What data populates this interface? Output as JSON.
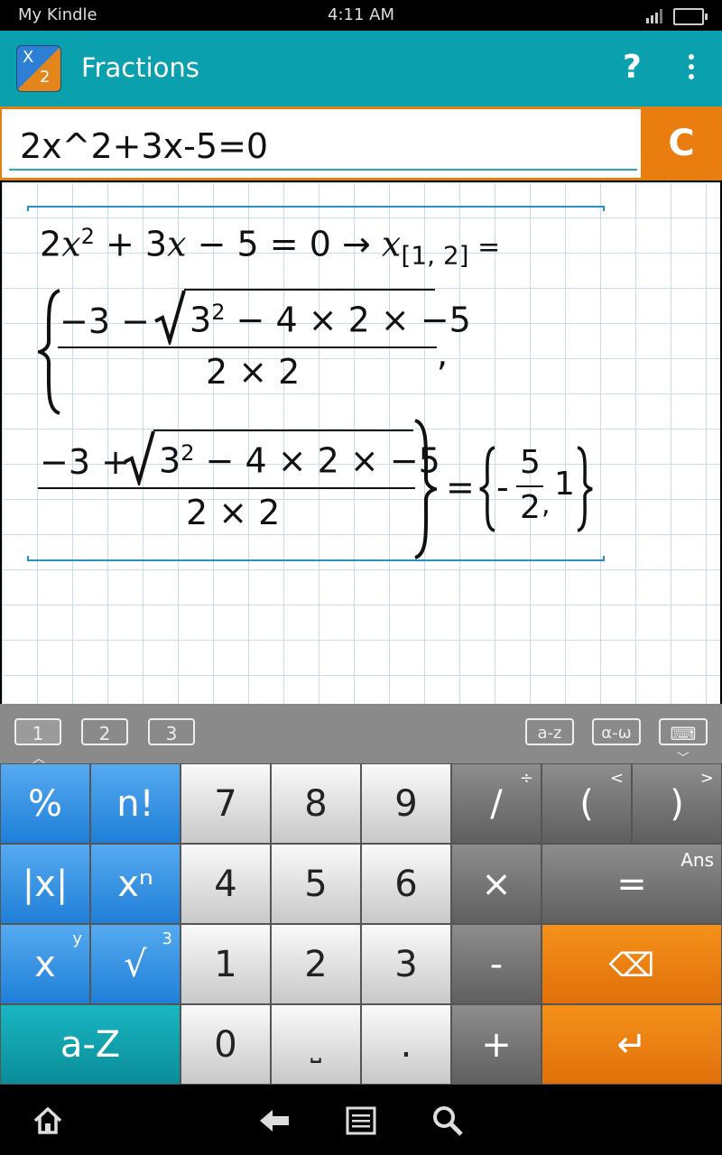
{
  "status_bar": {
    "carrier": "My Kindle",
    "time": "4:11 AM"
  },
  "action_bar": {
    "title": "Fractions",
    "help": "?",
    "app_icon_top": "X",
    "app_icon_bottom": "2"
  },
  "input": {
    "value": "2x^2+3x-5=0",
    "clear_label": "C"
  },
  "result": {
    "line1": {
      "a": "2",
      "x": "x",
      "sq": "2",
      "rest": " + 3",
      "x2": "x",
      "rest2": " − 5 = 0 → ",
      "x3": "x",
      "sub": "[1, 2]",
      "eq": " ="
    },
    "frac1": {
      "minus3": "−3 −",
      "radicand_base": "3",
      "radicand_exp": "2",
      "radicand_rest": " − 4 × 2 × −5",
      "den": "2 × 2",
      "comma": ","
    },
    "frac2": {
      "minus3": "−3 +",
      "radicand_base": "3",
      "radicand_exp": "2",
      "radicand_rest": " − 4 × 2 × −5",
      "den": "2 × 2"
    },
    "answer": {
      "eq": "=",
      "minus": "-",
      "num": "5",
      "den": "2",
      "comma": ",",
      "one": "1"
    }
  },
  "keyboard": {
    "tabs": [
      "1",
      "2",
      "3"
    ],
    "right_tabs": [
      "a-z",
      "α-ω"
    ],
    "rows": [
      [
        {
          "label": "%",
          "alt": ""
        },
        {
          "label": "n!",
          "alt": ""
        },
        {
          "label": "7",
          "alt": ""
        },
        {
          "label": "8",
          "alt": ""
        },
        {
          "label": "9",
          "alt": ""
        },
        {
          "label": "/",
          "alt": "÷"
        },
        {
          "label": "(",
          "alt": "<"
        },
        {
          "label": ")",
          "alt": ">"
        }
      ],
      [
        {
          "label": "|x|",
          "alt": ""
        },
        {
          "label": "xⁿ",
          "alt": ""
        },
        {
          "label": "4",
          "alt": ""
        },
        {
          "label": "5",
          "alt": ""
        },
        {
          "label": "6",
          "alt": ""
        },
        {
          "label": "×",
          "alt": ""
        },
        {
          "label": "=",
          "alt": "Ans"
        }
      ],
      [
        {
          "label": "x",
          "alt": "y"
        },
        {
          "label": "√",
          "alt": "3"
        },
        {
          "label": "1",
          "alt": ""
        },
        {
          "label": "2",
          "alt": ""
        },
        {
          "label": "3",
          "alt": ""
        },
        {
          "label": "-",
          "alt": ""
        },
        {
          "label": "⌫",
          "alt": ""
        }
      ],
      [
        {
          "label": "a-Z",
          "alt": ""
        },
        {
          "label": "0",
          "alt": ""
        },
        {
          "label": "⎵",
          "alt": ""
        },
        {
          "label": ".",
          "alt": ""
        },
        {
          "label": "+",
          "alt": ""
        },
        {
          "label": "↵",
          "alt": ""
        }
      ]
    ]
  }
}
